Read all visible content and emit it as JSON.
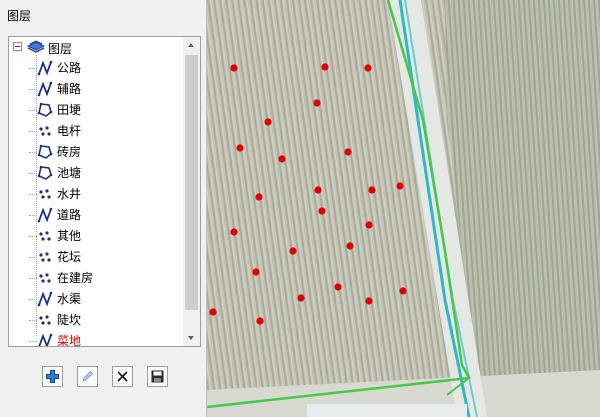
{
  "panel": {
    "title": "图层",
    "root": {
      "label": "图层",
      "expanded": true,
      "icon": "layers-icon"
    },
    "layers": [
      {
        "label": "公路",
        "icon": "line-layer-icon",
        "selected": false
      },
      {
        "label": "辅路",
        "icon": "line-layer-icon",
        "selected": false
      },
      {
        "label": "田埂",
        "icon": "polygon-layer-icon",
        "selected": false
      },
      {
        "label": "电杆",
        "icon": "point-layer-icon",
        "selected": false
      },
      {
        "label": "砖房",
        "icon": "polygon-layer-icon",
        "selected": false
      },
      {
        "label": "池塘",
        "icon": "polygon-layer-icon",
        "selected": false
      },
      {
        "label": "水井",
        "icon": "point-layer-icon",
        "selected": false
      },
      {
        "label": "道路",
        "icon": "line-layer-icon",
        "selected": false
      },
      {
        "label": "其他",
        "icon": "point-layer-icon",
        "selected": false
      },
      {
        "label": "花坛",
        "icon": "point-layer-icon",
        "selected": false
      },
      {
        "label": "在建房",
        "icon": "point-layer-icon",
        "selected": false
      },
      {
        "label": "水渠",
        "icon": "line-layer-icon",
        "selected": false
      },
      {
        "label": "陡坎",
        "icon": "point-layer-icon",
        "selected": false
      },
      {
        "label": "菜地",
        "icon": "line-layer-icon",
        "selected": true
      }
    ],
    "buttons": [
      {
        "name": "add-layer-button",
        "icon": "plus-icon"
      },
      {
        "name": "edit-layer-button",
        "icon": "pencil-icon"
      },
      {
        "name": "delete-layer-button",
        "icon": "close-icon"
      },
      {
        "name": "save-button",
        "icon": "floppy-disk-icon"
      }
    ]
  },
  "map": {
    "colors": {
      "point": "#e00000",
      "boundary": "#45c84a",
      "canal": "#2fb7c9"
    }
  }
}
